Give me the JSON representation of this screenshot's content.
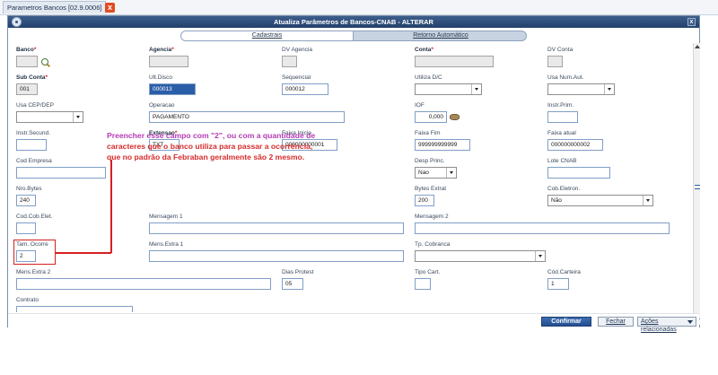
{
  "tab": {
    "title": "Parametros Bancos [02.9.0006]",
    "close_glyph": "x"
  },
  "window": {
    "title": "Atualiza Parâmetros de Bancos-CNAB - ALTERAR",
    "close_glyph": "x"
  },
  "subtabs": {
    "cadastrais": "Cadastrais",
    "retorno": "Retorno Automático"
  },
  "labels": {
    "banco": "Banco",
    "agencia": "Agencia",
    "dv_agencia": "DV Agencia",
    "conta": "Conta",
    "dv_conta": "DV Conta",
    "sub_conta": "Sub Conta",
    "ult_disco": "Ult.Disco",
    "sequencial": "Sequencial",
    "utiliza_dc": "Utiliza D/C",
    "usa_num_aut": "Usa Num.Aut.",
    "usa_cep_dep": "Usa CEP/DEP",
    "operacao": "Operacao",
    "iof": "IOF",
    "instr_prim": "Instr.Prim.",
    "instr_secund": "Instr.Secund.",
    "extensao": "Extensao",
    "faixa_inicio": "Faixa Inicio",
    "faixa_fim": "Faixa Fim",
    "faixa_atual": "Faixa atual",
    "cod_empresa": "Cod Empresa",
    "desp_princ": "Desp Princ.",
    "lote_cnab": "Lote CNAB",
    "nro_bytes": "Nro.Bytes",
    "bytes_extrat": "Bytes Extrat",
    "cob_eletron": "Cob.Eletron.",
    "cod_cob_elet": "Cod.Cob.Elet.",
    "mensagem1": "Mensagem 1",
    "mensagem2": "Mensagem 2",
    "tam_ocorre": "Tam. Ocorre",
    "mens_extra1": "Mens.Extra 1",
    "tp_cobranca": "Tp. Cobranca",
    "mens_extra2": "Mens.Extra 2",
    "dias_protest": "Dias Protest",
    "tipo_cart": "Tipo Cart.",
    "cod_carteira": "Cód.Carteira",
    "contrato": "Contrato",
    "required_mark": "*"
  },
  "values": {
    "banco": "",
    "agencia": "",
    "dv_agencia": "",
    "conta": "",
    "dv_conta": "",
    "sub_conta": "001",
    "ult_disco": "000013",
    "sequencial": "000012",
    "utiliza_dc": "",
    "usa_num_aut": "",
    "usa_cep_dep": "",
    "operacao": "PAGAMENTO",
    "iof": "0,000",
    "instr_prim": "",
    "instr_secund": "",
    "extensao": "TXT",
    "faixa_inicio": "000000000001",
    "faixa_fim": "999999999999",
    "faixa_atual": "000000000002",
    "cod_empresa": "",
    "desp_princ": "Nao",
    "lote_cnab": "",
    "nro_bytes": "240",
    "bytes_extrat": "200",
    "cob_eletron": "Não",
    "cod_cob_elet": "",
    "mensagem1": "",
    "mensagem2": "",
    "tam_ocorre": "2",
    "mens_extra1": "",
    "tp_cobranca": "",
    "mens_extra2": "",
    "dias_protest": "05",
    "tipo_cart": "",
    "cod_carteira": "1",
    "contrato": ""
  },
  "annotation": {
    "line1": "Preencher esse campo com \"2\", ou com a quantidade de",
    "line2": "caracteres que o banco utiliza para passar a ocorrência,",
    "line3": "que no padrão da Febraban geralmente são 2 mesmo."
  },
  "buttons": {
    "confirmar": "Confirmar",
    "fechar": "Fechar",
    "acoes": "Ações relacionadas"
  },
  "colors": {
    "annotation_red": "#d62c2c",
    "annotation_magenta": "#b43bb4",
    "primary_blue": "#2b5ea8"
  },
  "icons": {
    "banco_lookup": "search-icon",
    "iof_calc": "coins-icon"
  }
}
